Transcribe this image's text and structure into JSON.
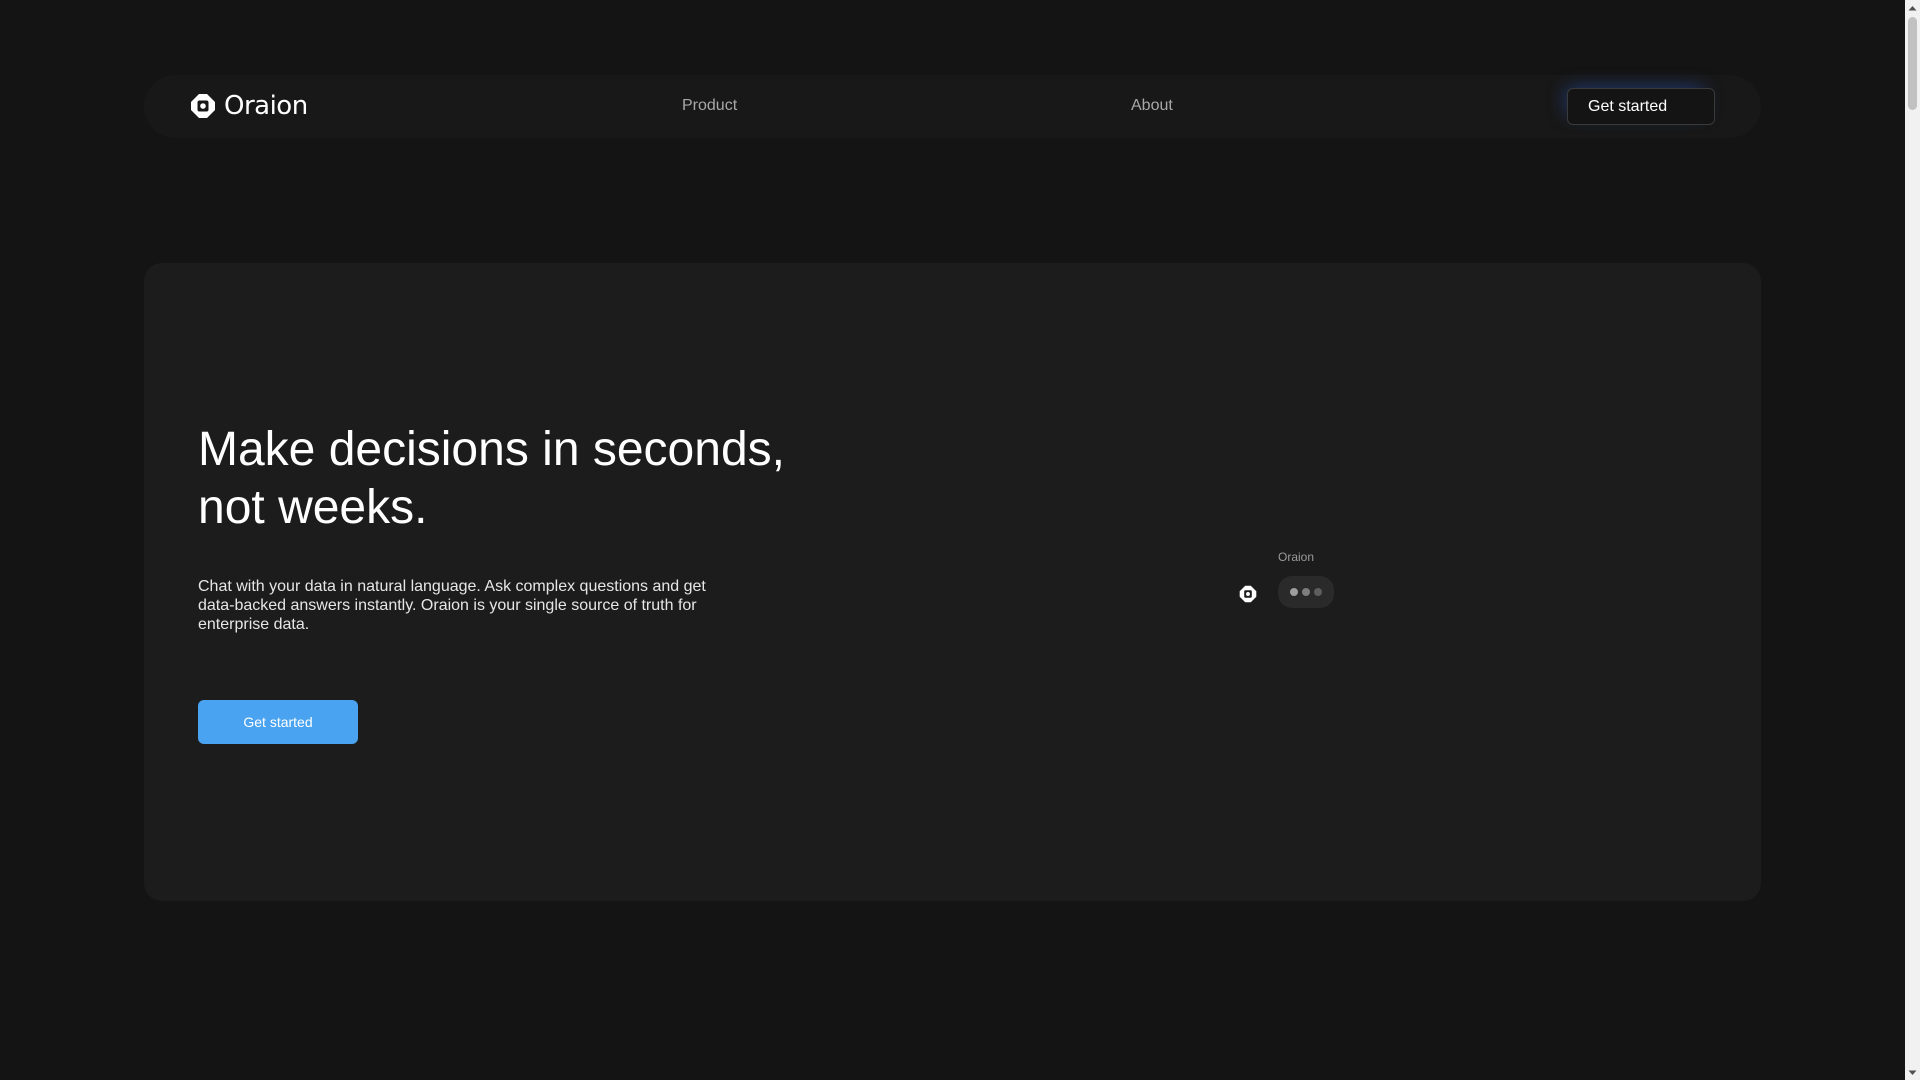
{
  "brand": {
    "name": "Oraion"
  },
  "nav": {
    "items": [
      {
        "label": "Product"
      },
      {
        "label": "About"
      }
    ],
    "cta_label": "Get started"
  },
  "hero": {
    "title_line1": "Make decisions in seconds,",
    "title_line2": "not weeks.",
    "description": "Chat with your data in natural language. Ask complex questions and get data-backed answers instantly. Oraion is your single source of truth for enterprise data.",
    "cta_label": "Get started"
  },
  "chat_preview": {
    "sender_name": "Oraion",
    "status": "typing"
  },
  "icons": {
    "logo": "oraion-logo-icon",
    "avatar": "oraion-avatar-icon",
    "scroll_up": "chevron-up-icon",
    "scroll_down": "chevron-down-icon"
  },
  "colors": {
    "background": "#141414",
    "card": "#1c1c1c",
    "accent": "#4aa3f0",
    "muted_text": "#a8a8a8"
  }
}
